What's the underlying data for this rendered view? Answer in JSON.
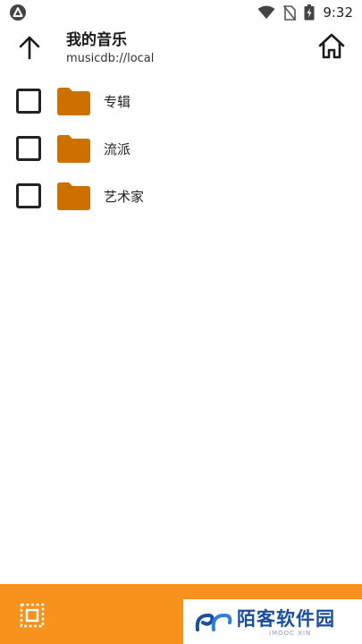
{
  "status_bar": {
    "time": "9:32",
    "icons": [
      "notification-a-icon",
      "wifi-icon",
      "no-sim-icon",
      "battery-icon"
    ]
  },
  "header": {
    "title": "我的音乐",
    "path": "musicdb://local"
  },
  "list": {
    "items": [
      {
        "label": "专辑",
        "checked": false
      },
      {
        "label": "流派",
        "checked": false
      },
      {
        "label": "艺术家",
        "checked": false
      }
    ]
  },
  "colors": {
    "accent": "#f7921c",
    "folder": "#cc7000"
  },
  "watermark": {
    "text": "陌客软件园",
    "sub": "IMOOC XIN"
  }
}
